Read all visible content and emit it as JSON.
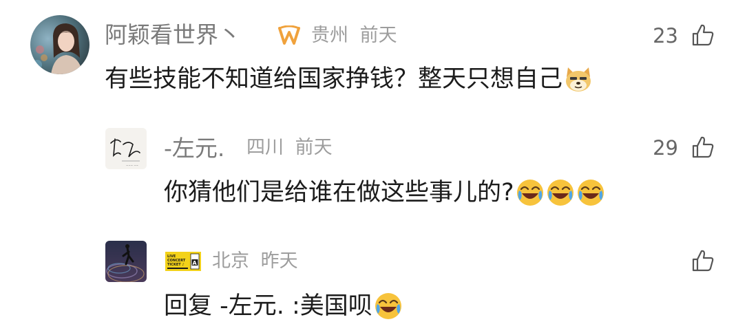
{
  "comments": [
    {
      "username": "阿颖看世界丶",
      "location": "贵州",
      "time": "前天",
      "text": "有些技能不知道给国家挣钱？整天只想自己",
      "likes": "23",
      "emojis": [
        "doge-emoji"
      ]
    },
    {
      "username": "-左元.",
      "location": "四川",
      "time": "前天",
      "text": "你猜他们是给谁在做这些事儿的?",
      "likes": "29",
      "emojis": [
        "laugh-cry-emoji",
        "laugh-cry-emoji",
        "laugh-cry-emoji"
      ]
    },
    {
      "username": "",
      "location": "北京",
      "time": "昨天",
      "text": "回复 -左元. :美国呗",
      "likes": "",
      "emojis": [
        "laugh-cry-emoji"
      ]
    }
  ],
  "icons": {
    "like": "thumbs-up-icon",
    "vip_badge": "vip-badge-icon",
    "ticket_badge": "concert-ticket-badge-icon"
  },
  "ticket_badge": {
    "line1": "LIVE",
    "line2": "CONCERT",
    "line3": "TICKET ♪",
    "letter": "A"
  },
  "colors": {
    "text": "#1c1c1c",
    "username": "#7a7a7a",
    "meta": "#9d9d9d",
    "badge_orange": "#f0a23c",
    "ticket_yellow": "#f3d21a"
  }
}
